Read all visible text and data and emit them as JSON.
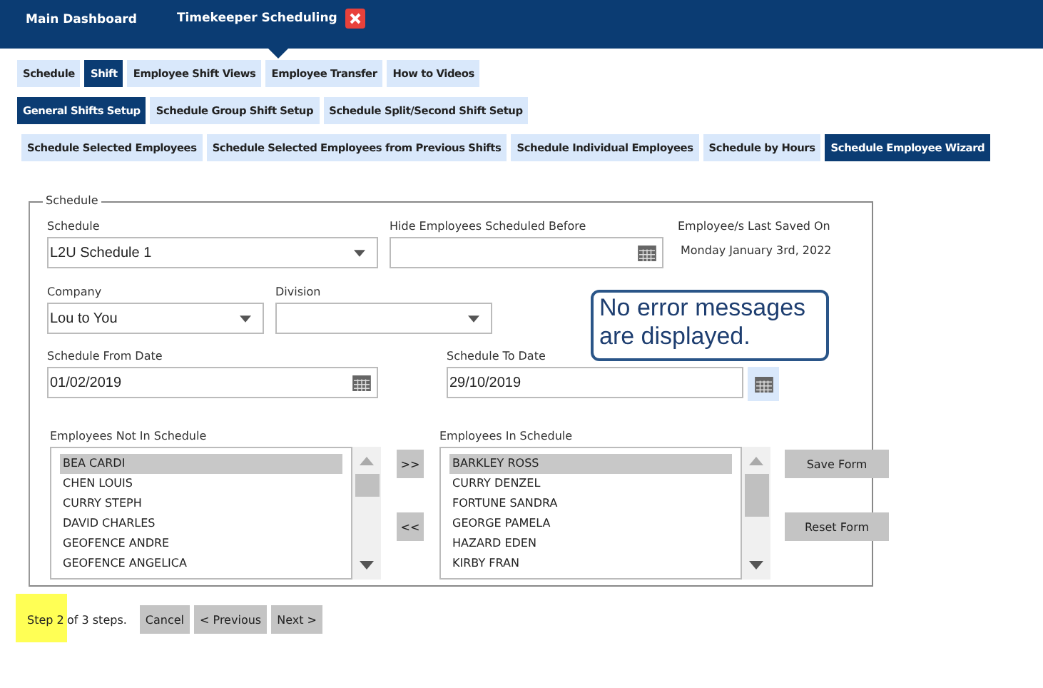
{
  "nav": {
    "tabs": [
      {
        "label": "Main Dashboard",
        "selected": false
      },
      {
        "label": "Timekeeper Scheduling",
        "selected": true
      }
    ]
  },
  "tab_rows": [
    [
      {
        "label": "Schedule",
        "selected": false
      },
      {
        "label": "Shift",
        "selected": true
      },
      {
        "label": "Employee Shift Views",
        "selected": false
      },
      {
        "label": "Employee Transfer",
        "selected": false
      },
      {
        "label": "How to Videos",
        "selected": false
      }
    ],
    [
      {
        "label": "General Shifts Setup",
        "selected": true
      },
      {
        "label": "Schedule Group Shift Setup",
        "selected": false
      },
      {
        "label": "Schedule Split/Second Shift Setup",
        "selected": false
      }
    ],
    [
      {
        "label": "Schedule Selected Employees",
        "selected": false
      },
      {
        "label": "Schedule Selected Employees from Previous Shifts",
        "selected": false
      },
      {
        "label": "Schedule Individual Employees",
        "selected": false
      },
      {
        "label": "Schedule by Hours",
        "selected": false
      },
      {
        "label": "Schedule Employee Wizard",
        "selected": true
      }
    ]
  ],
  "form": {
    "legend": "Schedule",
    "schedule": {
      "label": "Schedule",
      "value": "L2U Schedule 1"
    },
    "hide_before": {
      "label": "Hide Employees Scheduled Before"
    },
    "last_saved": {
      "label": "Employee/s Last Saved On",
      "value": "Monday January 3rd, 2022"
    },
    "company": {
      "label": "Company",
      "value": "Lou to You"
    },
    "division": {
      "label": "Division"
    },
    "from_date": {
      "label": "Schedule From Date",
      "value": "01/02/2019"
    },
    "to_date": {
      "label": "Schedule To Date",
      "value": "29/10/2019"
    },
    "not_in_schedule": {
      "label": "Employees Not In Schedule",
      "items": [
        {
          "name": "BEA CARDI",
          "selected": true
        },
        {
          "name": "CHEN LOUIS",
          "selected": false
        },
        {
          "name": "CURRY STEPH",
          "selected": false
        },
        {
          "name": "DAVID CHARLES",
          "selected": false
        },
        {
          "name": "GEOFENCE ANDRE",
          "selected": false
        },
        {
          "name": "GEOFENCE ANGELICA",
          "selected": false
        }
      ]
    },
    "move_buttons": [
      ">>",
      "<<"
    ],
    "in_schedule": {
      "label": "Employees In Schedule",
      "items": [
        {
          "name": "BARKLEY ROSS",
          "selected": true
        },
        {
          "name": "CURRY DENZEL",
          "selected": false
        },
        {
          "name": "FORTUNE SANDRA",
          "selected": false
        },
        {
          "name": "GEORGE PAMELA",
          "selected": false
        },
        {
          "name": "HAZARD EDEN",
          "selected": false
        },
        {
          "name": "KIRBY FRAN",
          "selected": false
        }
      ]
    },
    "form_buttons": [
      "Save Form",
      "Reset Form"
    ]
  },
  "callout": "No error messages are displayed.",
  "footer": {
    "step": "Step 2",
    "of_steps": "of 3 steps.",
    "buttons": [
      "Cancel",
      "< Previous",
      "Next >"
    ]
  }
}
